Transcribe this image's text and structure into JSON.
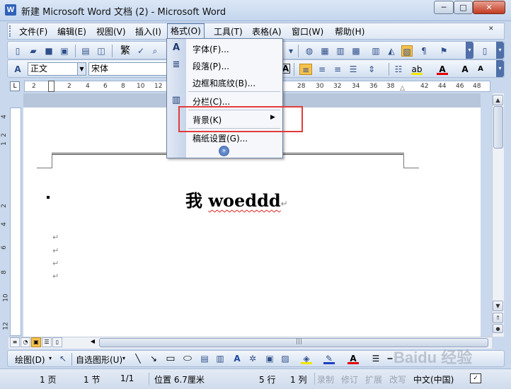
{
  "window": {
    "title": "新建 Microsoft Word 文档 (2) - Microsoft Word",
    "minimize": "─",
    "maximize": "□",
    "close": "✕"
  },
  "menubar": {
    "items": [
      "文件(F)",
      "编辑(E)",
      "视图(V)",
      "插入(I)",
      "格式(O)",
      "工具(T)",
      "表格(A)",
      "窗口(W)",
      "帮助(H)"
    ]
  },
  "toolbar2": {
    "style_value": "正文",
    "font_value": "宋体"
  },
  "ruler": {
    "h_numbers": [
      "2",
      "2",
      "4",
      "6",
      "8",
      "10",
      "12",
      "28",
      "30",
      "32",
      "34",
      "36",
      "38",
      "42",
      "44",
      "46",
      "48"
    ],
    "v_numbers": [
      "4",
      "2",
      "1",
      "2",
      "4",
      "6",
      "8",
      "10",
      "12"
    ]
  },
  "format_menu": {
    "items": [
      "字体(F)...",
      "段落(P)...",
      "边框和底纹(B)...",
      "分栏(C)...",
      "背景(K)",
      "稿纸设置(G)..."
    ],
    "submenu_arrow": "▶"
  },
  "document": {
    "heading_prefix": "我 ",
    "heading_word": "woeddd",
    "paragraph_mark": "↵"
  },
  "drawing_toolbar": {
    "draw_label": "绘图(D)",
    "autoshape_label": "自选图形(U)"
  },
  "statusbar": {
    "page": "1 页",
    "section": "1 节",
    "page_of": "1/1",
    "position": "位置 6.7厘米",
    "line": "5 行",
    "column": "1 列",
    "rec": "录制",
    "rev": "修订",
    "ext": "扩展",
    "ovr": "改写",
    "language": "中文(中国)"
  },
  "watermark": "Baidu 经验",
  "colors": {
    "highlight_border": "#e23b3b",
    "menu_active": "#dfe8f5"
  }
}
